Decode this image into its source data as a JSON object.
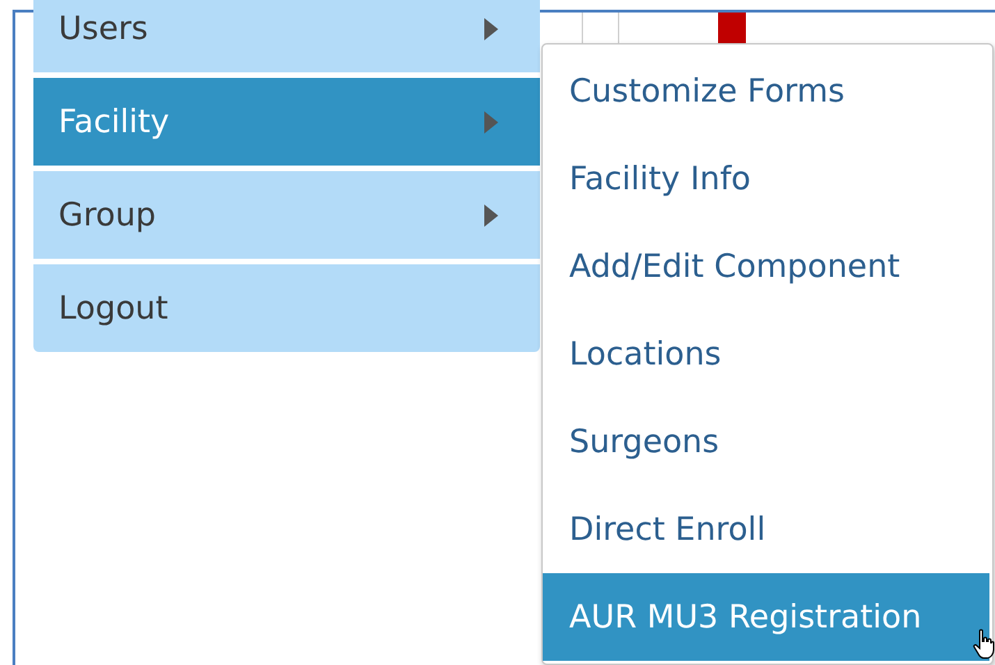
{
  "menu": {
    "items": [
      {
        "label": "Users",
        "selected": false,
        "submenu": true
      },
      {
        "label": "Facility",
        "selected": true,
        "submenu": true
      },
      {
        "label": "Group",
        "selected": false,
        "submenu": true
      },
      {
        "label": "Logout",
        "selected": false,
        "submenu": false
      }
    ]
  },
  "submenu": {
    "items": [
      {
        "label": "Customize Forms",
        "selected": false
      },
      {
        "label": "Facility Info",
        "selected": false
      },
      {
        "label": "Add/Edit Component",
        "selected": false
      },
      {
        "label": "Locations",
        "selected": false
      },
      {
        "label": "Surgeons",
        "selected": false
      },
      {
        "label": "Direct Enroll",
        "selected": false
      },
      {
        "label": "AUR MU3 Registration",
        "selected": true
      }
    ]
  }
}
